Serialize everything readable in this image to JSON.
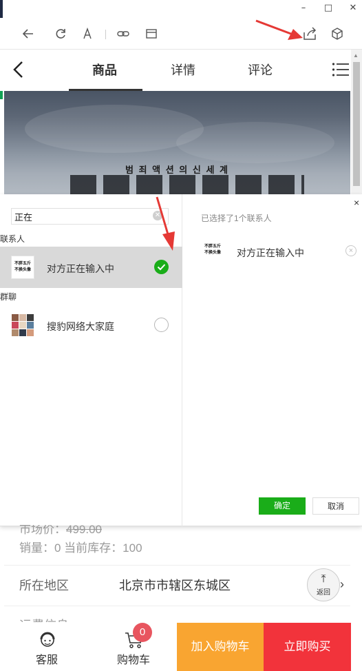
{
  "window": {
    "minimize": "–",
    "maximize": "□",
    "close": "✕"
  },
  "toolbar": {
    "icons": [
      "back-arrow-icon",
      "refresh-icon",
      "font-icon",
      "link-icon",
      "window-icon",
      "share-icon",
      "box-icon"
    ]
  },
  "page_nav": {
    "tabs": [
      {
        "label": "商品",
        "active": true
      },
      {
        "label": "详情",
        "active": false
      },
      {
        "label": "评论",
        "active": false
      }
    ]
  },
  "banner": {
    "subtitle": "범 죄 액 션 의   신 세 계"
  },
  "share_dialog": {
    "search": {
      "value": "正在",
      "clear": "✕"
    },
    "sections": {
      "contacts": "联系人",
      "groups": "群聊"
    },
    "contacts": [
      {
        "name": "对方正在输入中",
        "avatar_text": [
          "不胖五斤",
          "不换头像"
        ],
        "checked": true
      }
    ],
    "groups": [
      {
        "name": "搜豹网络大家庭",
        "checked": false
      }
    ],
    "close": "×",
    "selected_count": "已选择了1个联系人",
    "selected": [
      {
        "name": "对方正在输入中",
        "avatar_text": [
          "不胖五斤",
          "不换头像"
        ],
        "remove": "×"
      }
    ],
    "confirm_label": "确定",
    "cancel_label": "取消"
  },
  "product": {
    "market_price_label": "市场价：",
    "market_price_value": "499.00",
    "sales_text": "销量：0 当前库存：100",
    "location_label": "所在地区",
    "location_value": "北京市市辖区东城区",
    "location_arrow": "›",
    "peek_label": "运费信息",
    "back_top": {
      "arrow": "⤒",
      "label": "返回"
    }
  },
  "bottom_bar": {
    "service_label": "客服",
    "cart_label": "购物车",
    "cart_count": "0",
    "add_to_cart": "加入购物车",
    "buy_now": "立即购买"
  },
  "colors": {
    "confirm": "#1aad19",
    "add_to_cart": "#f9a531",
    "buy_now": "#f2333b",
    "badge": "#e8555f",
    "annotation": "#e53935"
  }
}
